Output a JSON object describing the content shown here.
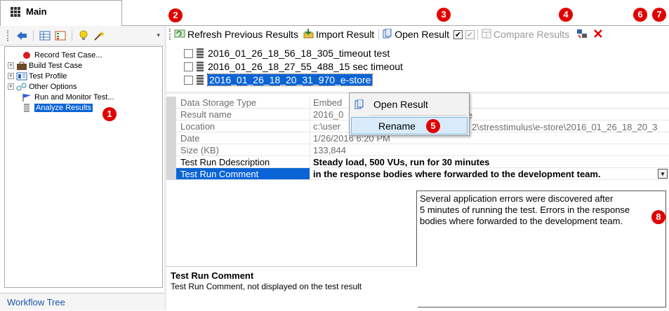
{
  "tab": {
    "label": "Main"
  },
  "tree": {
    "items": [
      {
        "label": "Record Test Case...",
        "expandable": false
      },
      {
        "label": "Build Test Case",
        "expandable": true
      },
      {
        "label": "Test Profile",
        "expandable": true
      },
      {
        "label": "Other Options",
        "expandable": true
      },
      {
        "label": "Run and Monitor Test...",
        "expandable": false
      },
      {
        "label": "Analyze Results",
        "expandable": false,
        "selected": true
      }
    ],
    "footer": "Workflow Tree"
  },
  "toolbar": {
    "refresh_label": "Refresh Previous Results",
    "import_label": "Import Result",
    "open_label": "Open Result",
    "compare_label": "Compare Results",
    "check_mark": "✔"
  },
  "results": [
    {
      "label": "2016_01_26_18_56_18_305_timeout test"
    },
    {
      "label": "2016_01_26_18_27_55_488_15 sec timeout"
    },
    {
      "label": "2016_01_26_18_20_31_970_e-store"
    }
  ],
  "properties": [
    {
      "name": "Data Storage Type",
      "value": "Embed"
    },
    {
      "name": "Result name",
      "value": "2016_0"
    },
    {
      "name": "Location",
      "value": "c:\\user"
    },
    {
      "name": "Date",
      "value": "1/26/2016 6:20 PM"
    },
    {
      "name": "Size (KB)",
      "value": "133,844"
    },
    {
      "name": "Test Run Ddescription",
      "value": "Steady load, 500 VUs,  run for 30 minutes"
    },
    {
      "name": "Test Run Comment",
      "value": "in the response bodies where forwarded to the development team."
    }
  ],
  "property_overflow": {
    "name_suffix": "e",
    "location_suffix": "2\\stresstimulus\\e-store\\2016_01_26_18_20_3"
  },
  "context_menu": {
    "items": [
      {
        "label": "Open Result"
      },
      {
        "label": "Rename"
      }
    ]
  },
  "comment_popup": {
    "lines": [
      "Several application errors were discovered after",
      "5 minutes of running the test. Errors in the response",
      "bodies where forwarded to the development team."
    ]
  },
  "help": {
    "title": "Test Run Comment",
    "description": "Test Run Comment, not displayed on the test result"
  },
  "badges": [
    "1",
    "2",
    "3",
    "4",
    "5",
    "6",
    "7",
    "8"
  ],
  "colors": {
    "selection": "#0a64d6",
    "badge": "#e00000",
    "close": "#e00000"
  }
}
